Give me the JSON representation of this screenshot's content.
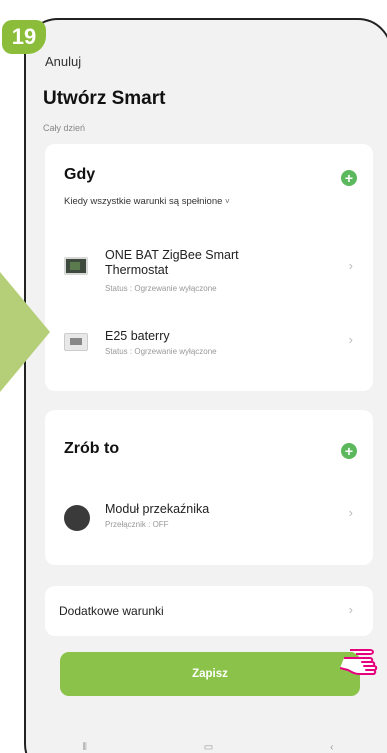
{
  "step_badge": "19",
  "header": {
    "cancel_label": "Anuluj",
    "title": "Utwórz Smart",
    "subtitle": "Cały dzień"
  },
  "when_section": {
    "title": "Gdy",
    "condition_label": "Kiedy wszystkie warunki są spełnione",
    "condition_dropdown_glyph": "˅",
    "add_icon": "plus-icon",
    "items": [
      {
        "name": "ONE BAT ZigBee Smart Thermostat",
        "status": "Status : Ogrzewanie wyłączone",
        "icon": "thermostat-icon"
      },
      {
        "name": "E25 baterry",
        "status": "Status : Ogrzewanie wyłączone",
        "icon": "thermostat-icon"
      }
    ]
  },
  "then_section": {
    "title": "Zrób to",
    "add_icon": "plus-icon",
    "items": [
      {
        "name": "Moduł przekaźnika",
        "status": "Przełącznik : OFF",
        "icon": "relay-module-icon"
      }
    ]
  },
  "additional_conditions": {
    "label": "Dodatkowe warunki"
  },
  "save_button": {
    "label": "Zapisz"
  },
  "colors": {
    "accent": "#8bc34a",
    "plus": "#5cb85c",
    "badge": "#8bbd3a",
    "arrow": "#b5cf78",
    "hand": "#e6007e"
  }
}
